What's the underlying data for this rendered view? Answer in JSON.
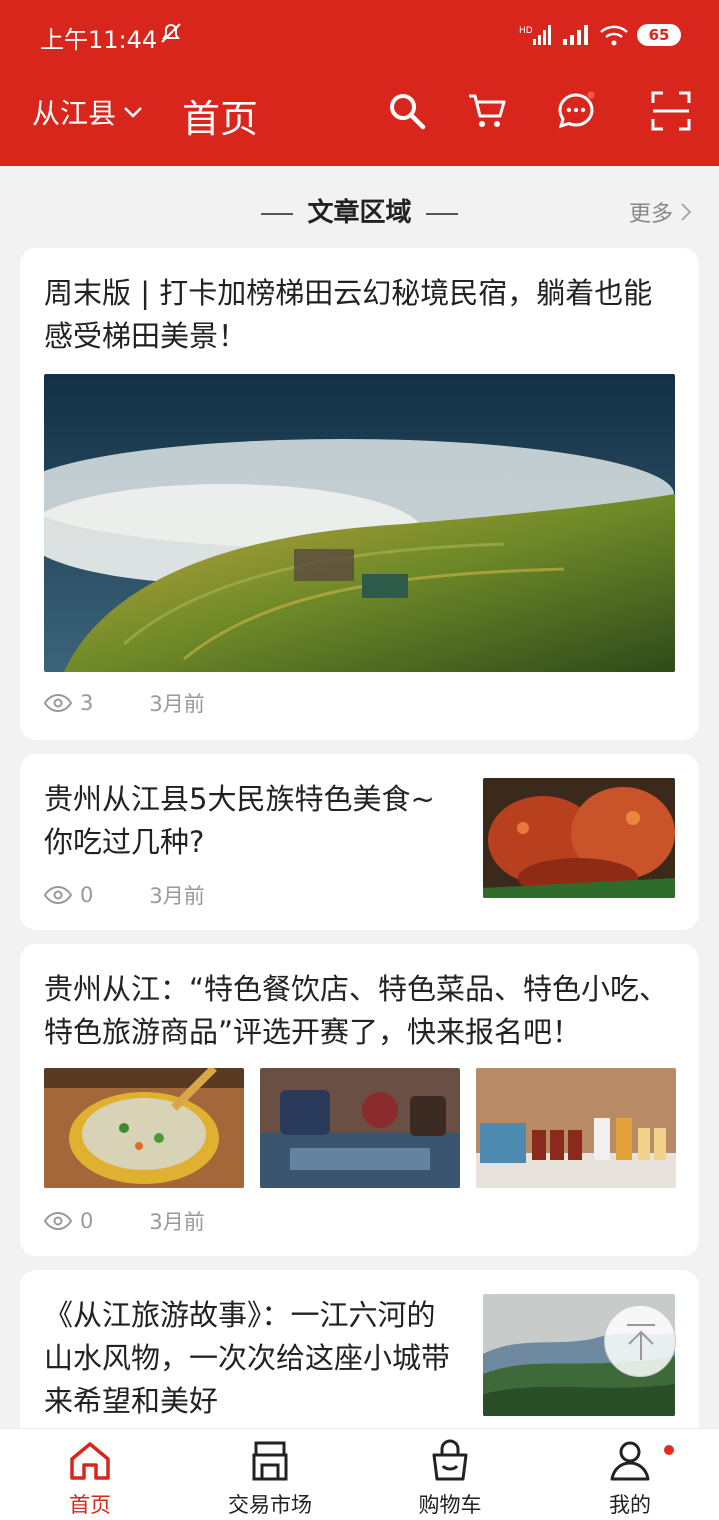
{
  "status_bar": {
    "time": "上午11:44",
    "battery": "65"
  },
  "header": {
    "location": "从江县",
    "title": "首页"
  },
  "section": {
    "title": "文章区域",
    "more": "更多"
  },
  "articles": [
    {
      "title": "周末版 | 打卡加榜梯田云幻秘境民宿，躺着也能感受梯田美景！",
      "views": "3",
      "time": "3月前"
    },
    {
      "title": "贵州从江县5大民族特色美食~你吃过几种?",
      "views": "0",
      "time": "3月前"
    },
    {
      "title": "贵州从江：“特色餐饮店、特色菜品、特色小吃、特色旅游商品”评选开赛了，快来报名吧！",
      "views": "0",
      "time": "3月前"
    },
    {
      "title": "《从江旅游故事》：一江六河的山水风物，一次次给这座小城带来希望和美好"
    }
  ],
  "tabbar": [
    {
      "label": "首页",
      "icon": "home-icon",
      "active": true
    },
    {
      "label": "交易市场",
      "icon": "market-icon"
    },
    {
      "label": "购物车",
      "icon": "bag-icon"
    },
    {
      "label": "我的",
      "icon": "user-icon"
    }
  ],
  "colors": {
    "brand": "#d9261c",
    "background": "#f2f2f2",
    "meta_text": "#999999"
  }
}
